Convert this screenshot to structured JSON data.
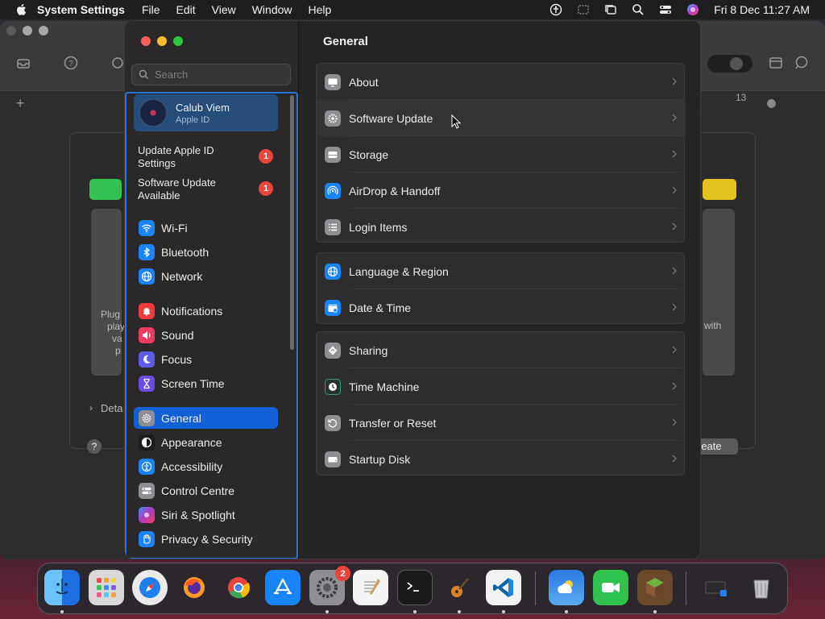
{
  "menubar": {
    "app_name": "System Settings",
    "menus": [
      "File",
      "Edit",
      "View",
      "Window",
      "Help"
    ],
    "clock": "Fri 8 Dec  11:27 AM"
  },
  "background_window": {
    "left_text_lines": [
      "Plug",
      "play",
      "va",
      "p"
    ],
    "right_text": "with",
    "details_label": "Deta",
    "create_label": "reate",
    "tab_number": "13",
    "help_label": "?"
  },
  "settings": {
    "search_placeholder": "Search",
    "account": {
      "name": "Calub Viem",
      "subtitle": "Apple ID"
    },
    "notices": [
      {
        "label": "Update Apple ID Settings",
        "badge": "1"
      },
      {
        "label": "Software Update Available",
        "badge": "1"
      }
    ],
    "sidebar_items": [
      {
        "label": "Wi-Fi",
        "icon": "wifi-icon",
        "color": "#1a84ff"
      },
      {
        "label": "Bluetooth",
        "icon": "bluetooth-icon",
        "color": "#1a84ff"
      },
      {
        "label": "Network",
        "icon": "globe-icon",
        "color": "#1a84ff"
      },
      {
        "label": "Notifications",
        "icon": "bell-icon",
        "color": "#ee3b3b"
      },
      {
        "label": "Sound",
        "icon": "speaker-icon",
        "color": "#ee3b5c"
      },
      {
        "label": "Focus",
        "icon": "moon-icon",
        "color": "#5e5ce6"
      },
      {
        "label": "Screen Time",
        "icon": "hourglass-icon",
        "color": "#6a4de0"
      },
      {
        "label": "General",
        "icon": "gear-icon",
        "color": "#8e8e93",
        "selected": true
      },
      {
        "label": "Appearance",
        "icon": "appearance-icon",
        "color": "#1c1c1e"
      },
      {
        "label": "Accessibility",
        "icon": "accessibility-icon",
        "color": "#1a84ff"
      },
      {
        "label": "Control Centre",
        "icon": "toggles-icon",
        "color": "#8e8e93"
      },
      {
        "label": "Siri & Spotlight",
        "icon": "siri-icon",
        "color": "#b03ab8"
      },
      {
        "label": "Privacy & Security",
        "icon": "hand-icon",
        "color": "#1a84ff"
      }
    ],
    "content_title": "General",
    "groups": [
      [
        {
          "label": "About",
          "icon": "display-icon",
          "color": "#8e8e93"
        },
        {
          "label": "Software Update",
          "icon": "gear-badge-icon",
          "color": "#8e8e93",
          "hover": true
        },
        {
          "label": "Storage",
          "icon": "drive-icon",
          "color": "#8e8e93"
        },
        {
          "label": "AirDrop & Handoff",
          "icon": "airdrop-icon",
          "color": "#1a84ff"
        },
        {
          "label": "Login Items",
          "icon": "list-icon",
          "color": "#8e8e93"
        }
      ],
      [
        {
          "label": "Language & Region",
          "icon": "globe-icon",
          "color": "#1a84ff"
        },
        {
          "label": "Date & Time",
          "icon": "calendar-icon",
          "color": "#1a84ff"
        }
      ],
      [
        {
          "label": "Sharing",
          "icon": "sharing-icon",
          "color": "#8e8e93"
        },
        {
          "label": "Time Machine",
          "icon": "clock-icon",
          "color": "#2e2e2e"
        },
        {
          "label": "Transfer or Reset",
          "icon": "reset-icon",
          "color": "#8e8e93"
        },
        {
          "label": "Startup Disk",
          "icon": "disk-icon",
          "color": "#8e8e93"
        }
      ]
    ]
  },
  "dock": {
    "apps": [
      {
        "name": "finder",
        "color": "#2a8cf2",
        "running": true
      },
      {
        "name": "launchpad",
        "color": "#d8d8d8",
        "running": false
      },
      {
        "name": "safari",
        "color": "#1f7ef0",
        "running": false
      },
      {
        "name": "firefox",
        "color": "#ff6a22",
        "running": false
      },
      {
        "name": "chrome",
        "color": "#f2f2f2",
        "running": false
      },
      {
        "name": "app-store",
        "color": "#1a84ff",
        "running": false
      },
      {
        "name": "system-settings",
        "color": "#8e8e93",
        "running": true,
        "badge": "2"
      },
      {
        "name": "textedit",
        "color": "#f4f4f4",
        "running": false
      },
      {
        "name": "terminal",
        "color": "#1a1a1a",
        "running": true
      },
      {
        "name": "garageband",
        "color": "#3a2a22",
        "running": true
      },
      {
        "name": "vscode",
        "color": "#f2f2f2",
        "running": true
      },
      {
        "name": "weather",
        "color": "#2a7be4",
        "running": true
      },
      {
        "name": "facetime",
        "color": "#2fc24f",
        "running": false
      },
      {
        "name": "minecraft",
        "color": "#5c8a3a",
        "running": true
      },
      {
        "name": "window-preview",
        "color": "#2a2a2c",
        "running": false
      },
      {
        "name": "trash",
        "color": "#9a9a9e",
        "running": false
      }
    ]
  }
}
